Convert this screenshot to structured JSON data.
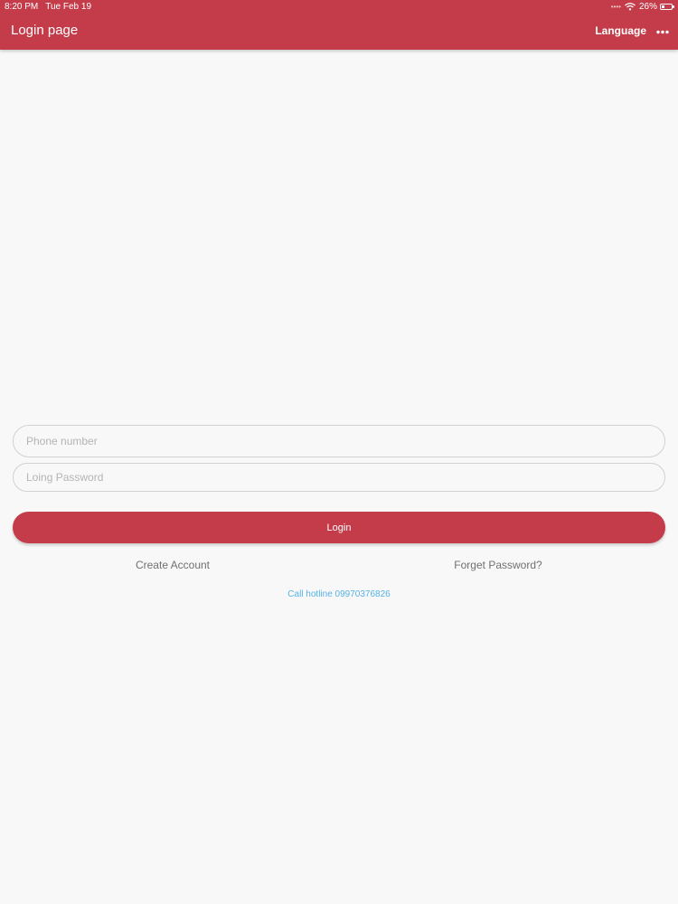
{
  "status_bar": {
    "time": "8:20 PM",
    "date": "Tue Feb 19",
    "battery_percent": "26%",
    "battery_level": 0.26,
    "icons": [
      "signal-dots-icon",
      "wifi-icon",
      "battery-icon"
    ]
  },
  "nav": {
    "title": "Login page",
    "language_label": "Language",
    "more_icon": "more-dots-icon"
  },
  "form": {
    "phone_placeholder": "Phone number",
    "password_placeholder": "Loing Password",
    "login_label": "Login",
    "create_account_label": "Create Account",
    "forget_password_label": "Forget Password?",
    "hotline_text": "Call hotline 09970376826"
  },
  "colors": {
    "brand": "#c43c4a",
    "background": "#f9f8f8",
    "link": "#707070",
    "hotline": "#55b2e6"
  }
}
